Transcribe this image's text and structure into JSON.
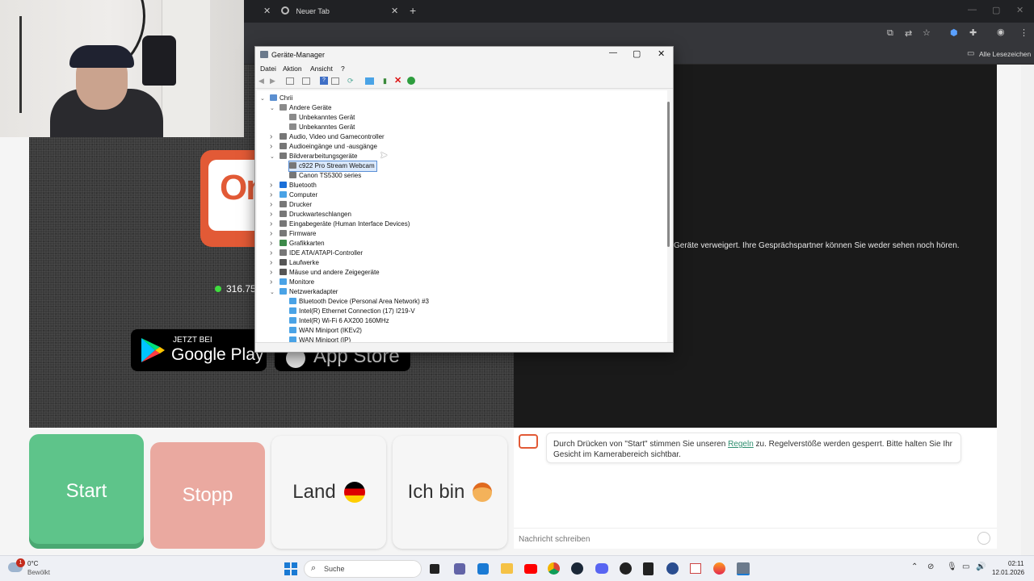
{
  "browser": {
    "tab_title": "Neuer Tab",
    "bookmarks_label": "Alle Lesezeichen"
  },
  "page": {
    "counter": "316.75",
    "google_play": {
      "small": "JETZT BEI",
      "big": "Google Play"
    },
    "app_store": {
      "big": "App Store"
    },
    "denied_message": "Geräte verweigert. Ihre Gesprächspartner können Sie weder sehen noch hören.",
    "buttons": {
      "start": "Start",
      "stop": "Stopp",
      "country": "Land",
      "iam": "Ich bin"
    },
    "info": {
      "prefix": "Durch Drücken von \"Start\" stimmen Sie unseren ",
      "link": "Regeln",
      "suffix": " zu. Regelverstöße werden gesperrt. Bitte halten Sie Ihr Gesicht im Kamerabereich sichtbar."
    },
    "chat_placeholder": "Nachricht schreiben",
    "logo_text": "Ome TV"
  },
  "devmgr": {
    "title": "Geräte-Manager",
    "menu": [
      "Datei",
      "Aktion",
      "Ansicht",
      "?"
    ],
    "tree": [
      {
        "label": "Chrii",
        "indent": 0,
        "arrow": "v",
        "icon": "computer-icon",
        "color": "#5b8fd0"
      },
      {
        "label": "Andere Geräte",
        "indent": 1,
        "arrow": "v",
        "icon": "unknown-device-icon",
        "color": "#8a8a8a"
      },
      {
        "label": "Unbekanntes Gerät",
        "indent": 2,
        "arrow": "",
        "icon": "unknown-device-icon",
        "color": "#8a8a8a"
      },
      {
        "label": "Unbekanntes Gerät",
        "indent": 2,
        "arrow": "",
        "icon": "unknown-device-icon",
        "color": "#8a8a8a"
      },
      {
        "label": "Audio, Video und Gamecontroller",
        "indent": 1,
        "arrow": ">",
        "icon": "speaker-icon",
        "color": "#777"
      },
      {
        "label": "Audioeingänge und -ausgänge",
        "indent": 1,
        "arrow": ">",
        "icon": "speaker-icon",
        "color": "#777"
      },
      {
        "label": "Bildverarbeitungsgeräte",
        "indent": 1,
        "arrow": "v",
        "icon": "camera-icon",
        "color": "#777"
      },
      {
        "label": "c922 Pro Stream Webcam",
        "indent": 2,
        "arrow": "",
        "icon": "camera-icon",
        "color": "#777",
        "selected": true
      },
      {
        "label": "Canon TS5300 series",
        "indent": 2,
        "arrow": "",
        "icon": "camera-icon",
        "color": "#777"
      },
      {
        "label": "Bluetooth",
        "indent": 1,
        "arrow": ">",
        "icon": "bluetooth-icon",
        "color": "#1a6fd8"
      },
      {
        "label": "Computer",
        "indent": 1,
        "arrow": ">",
        "icon": "monitor-icon",
        "color": "#4aa3e6"
      },
      {
        "label": "Drucker",
        "indent": 1,
        "arrow": ">",
        "icon": "printer-icon",
        "color": "#777"
      },
      {
        "label": "Druckwarteschlangen",
        "indent": 1,
        "arrow": ">",
        "icon": "printer-icon",
        "color": "#777"
      },
      {
        "label": "Eingabegeräte (Human Interface Devices)",
        "indent": 1,
        "arrow": ">",
        "icon": "hid-icon",
        "color": "#777"
      },
      {
        "label": "Firmware",
        "indent": 1,
        "arrow": ">",
        "icon": "chip-icon",
        "color": "#777"
      },
      {
        "label": "Grafikkarten",
        "indent": 1,
        "arrow": ">",
        "icon": "graphics-card-icon",
        "color": "#3d8a4a"
      },
      {
        "label": "IDE ATA/ATAPI-Controller",
        "indent": 1,
        "arrow": ">",
        "icon": "controller-icon",
        "color": "#777"
      },
      {
        "label": "Laufwerke",
        "indent": 1,
        "arrow": ">",
        "icon": "drive-icon",
        "color": "#555"
      },
      {
        "label": "Mäuse und andere Zeigegeräte",
        "indent": 1,
        "arrow": ">",
        "icon": "mouse-icon",
        "color": "#555"
      },
      {
        "label": "Monitore",
        "indent": 1,
        "arrow": ">",
        "icon": "monitor-icon",
        "color": "#4aa3e6"
      },
      {
        "label": "Netzwerkadapter",
        "indent": 1,
        "arrow": "v",
        "icon": "network-icon",
        "color": "#4aa3e6"
      },
      {
        "label": "Bluetooth Device (Personal Area Network) #3",
        "indent": 2,
        "arrow": "",
        "icon": "network-icon",
        "color": "#4aa3e6"
      },
      {
        "label": "Intel(R) Ethernet Connection (17) I219-V",
        "indent": 2,
        "arrow": "",
        "icon": "network-icon",
        "color": "#4aa3e6"
      },
      {
        "label": "Intel(R) Wi-Fi 6 AX200 160MHz",
        "indent": 2,
        "arrow": "",
        "icon": "network-icon",
        "color": "#4aa3e6"
      },
      {
        "label": "WAN Miniport (IKEv2)",
        "indent": 2,
        "arrow": "",
        "icon": "network-icon",
        "color": "#4aa3e6"
      },
      {
        "label": "WAN Miniport (IP)",
        "indent": 2,
        "arrow": "",
        "icon": "network-icon",
        "color": "#4aa3e6"
      }
    ]
  },
  "taskbar": {
    "weather_temp": "0°C",
    "weather_desc": "Bewölkt",
    "weather_badge": "1",
    "search": "Suche",
    "time": "02:11",
    "date": "12.01.2026"
  }
}
